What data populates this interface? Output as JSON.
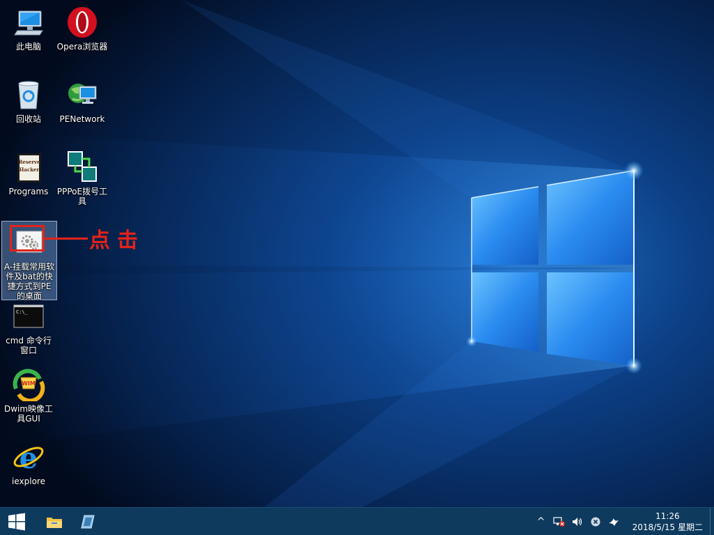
{
  "desktop": {
    "icons": [
      {
        "id": "this-pc",
        "label": "此电脑",
        "icon": "computer-icon"
      },
      {
        "id": "opera",
        "label": "Opera浏览器",
        "icon": "opera-icon"
      },
      {
        "id": "recycle-bin",
        "label": "回收站",
        "icon": "recycle-bin-icon"
      },
      {
        "id": "penetwork",
        "label": "PENetwork",
        "icon": "network-globe-icon"
      },
      {
        "id": "programs",
        "label": "Programs",
        "icon": "programs-icon"
      },
      {
        "id": "pppoe",
        "label": "PPPoE拨号工具",
        "icon": "pppoe-dialer-icon"
      },
      {
        "id": "mount-tools",
        "label": "A-挂载常用软件及bat的快捷方式到PE的桌面",
        "icon": "settings-gears-icon",
        "selected": true
      },
      {
        "id": "cmd",
        "label": "cmd 命令行窗口",
        "icon": "cmd-icon"
      },
      {
        "id": "dwim",
        "label": "Dwim映像工具GUI",
        "icon": "wim-image-tool-icon"
      },
      {
        "id": "iexplore",
        "label": "iexplore",
        "icon": "internet-explorer-icon"
      }
    ],
    "annotation": {
      "text": "点击",
      "color": "#e2231a"
    }
  },
  "taskbar": {
    "start": "windows-start-icon",
    "pinned": [
      "file-explorer-icon",
      "disk-tool-icon"
    ],
    "tray": {
      "chevron": "^",
      "icons": [
        "network-error-icon",
        "volume-icon",
        "close-circle-icon",
        "bird-icon"
      ]
    },
    "clock": {
      "time": "11:26",
      "date": "2018/5/15 星期二"
    }
  },
  "colors": {
    "taskbar": "#0e3a5e",
    "wallpaper_glow": "#3da7ff",
    "selection": "#78a0d2"
  }
}
